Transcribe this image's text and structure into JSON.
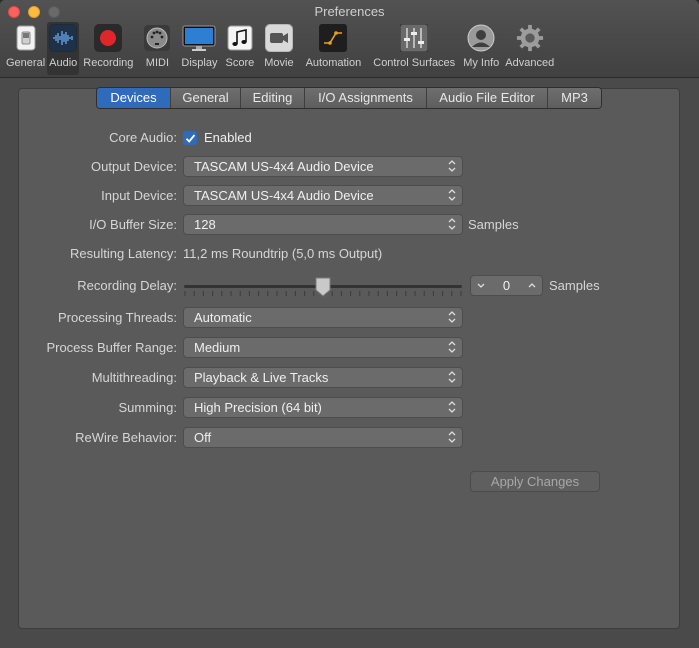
{
  "window": {
    "title": "Preferences"
  },
  "toolbar": {
    "items": [
      {
        "label": "General",
        "icon": "general-switch-icon"
      },
      {
        "label": "Audio",
        "icon": "audio-waveform-icon"
      },
      {
        "label": "Recording",
        "icon": "record-icon"
      },
      {
        "label": "MIDI",
        "icon": "midi-connector-icon"
      },
      {
        "label": "Display",
        "icon": "display-monitor-icon"
      },
      {
        "label": "Score",
        "icon": "music-note-icon"
      },
      {
        "label": "Movie",
        "icon": "movie-camera-icon"
      },
      {
        "label": "Automation",
        "icon": "automation-curve-icon"
      },
      {
        "label": "Control Surfaces",
        "icon": "mixer-faders-icon"
      },
      {
        "label": "My Info",
        "icon": "user-avatar-icon"
      },
      {
        "label": "Advanced",
        "icon": "gear-icon"
      }
    ],
    "selected": "Audio"
  },
  "tabs": {
    "items": [
      "Devices",
      "General",
      "Editing",
      "I/O Assignments",
      "Audio File Editor",
      "MP3"
    ],
    "selected": "Devices"
  },
  "settings": {
    "core_audio": {
      "label": "Core Audio:",
      "checkbox_label": "Enabled",
      "checked": true
    },
    "output_device": {
      "label": "Output Device:",
      "value": "TASCAM US-4x4 Audio Device"
    },
    "input_device": {
      "label": "Input Device:",
      "value": "TASCAM US-4x4 Audio Device"
    },
    "io_buffer_size": {
      "label": "I/O Buffer Size:",
      "value": "128",
      "unit": "Samples"
    },
    "resulting_latency": {
      "label": "Resulting Latency:",
      "value": "11,2 ms Roundtrip (5,0 ms Output)"
    },
    "recording_delay": {
      "label": "Recording Delay:",
      "value": "0",
      "unit": "Samples",
      "slider_fraction": 0.5
    },
    "processing_threads": {
      "label": "Processing Threads:",
      "value": "Automatic"
    },
    "process_buffer_range": {
      "label": "Process Buffer Range:",
      "value": "Medium"
    },
    "multithreading": {
      "label": "Multithreading:",
      "value": "Playback & Live Tracks"
    },
    "summing": {
      "label": "Summing:",
      "value": "High Precision (64 bit)"
    },
    "rewire_behavior": {
      "label": "ReWire Behavior:",
      "value": "Off"
    }
  },
  "actions": {
    "apply_label": "Apply Changes",
    "apply_enabled": false
  },
  "colors": {
    "accent": "#2e6bba",
    "record": "#e0262b",
    "automation": "#e8a322"
  }
}
